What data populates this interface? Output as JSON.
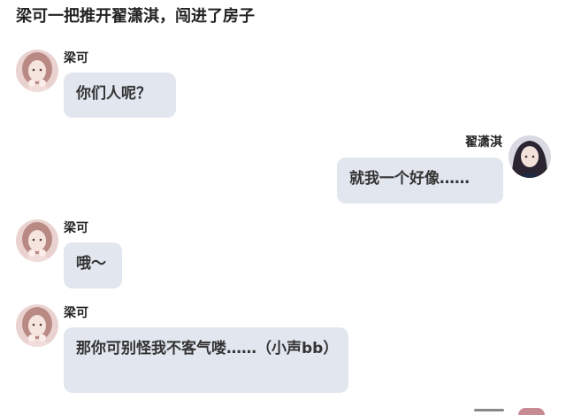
{
  "narration": "梁可一把推开翟潇淇，闯进了房子",
  "colors": {
    "bubble": "#e1e6ef",
    "text": "#333333",
    "name": "#222222"
  },
  "messages": [
    {
      "sender": "梁可",
      "side": "left",
      "text": "你们人呢？"
    },
    {
      "sender": "翟潇淇",
      "side": "right",
      "text": "就我一个好像……"
    },
    {
      "sender": "梁可",
      "side": "left",
      "text": "哦～"
    },
    {
      "sender": "梁可",
      "side": "left",
      "text": "那你可别怪我不客气喽……（小声bb）"
    }
  ]
}
